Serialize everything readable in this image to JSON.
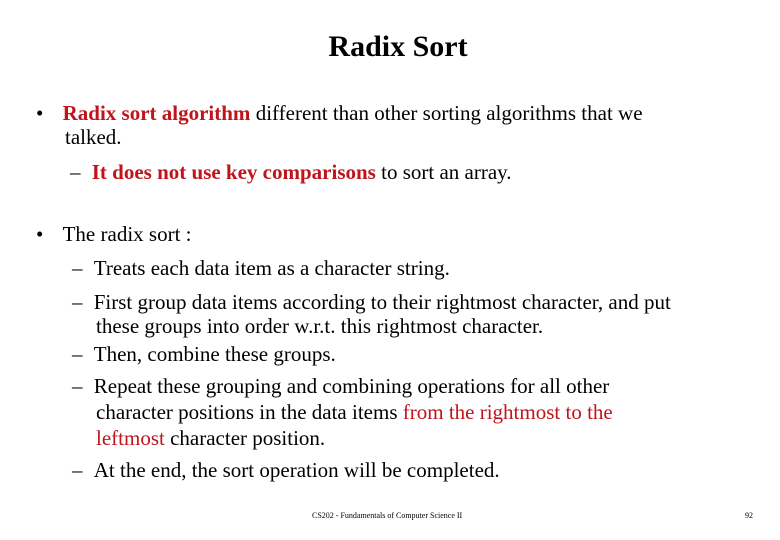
{
  "slide": {
    "title": "Radix Sort",
    "bullets": {
      "b1": {
        "marker": "•",
        "red_bold": "Radix sort algorithm",
        "rest": " different than other sorting algorithms that we",
        "cont": "talked.",
        "sub1": {
          "marker": "–",
          "red_bold": "It does not use key comparisons",
          "rest": " to sort an array."
        }
      },
      "b2": {
        "marker": "•",
        "text": "The radix sort :",
        "s1": "Treats each data item as a character string.",
        "s2a": "First group data items according to their rightmost character, and put",
        "s2b": "these groups into order w.r.t. this rightmost character.",
        "s3": "Then, combine these groups.",
        "s4a": "Repeat these grouping and combining operations for all other",
        "s4b_black": "character positions in the data items ",
        "s4b_red": "from the rightmost to the",
        "s4c_red": "leftmost",
        "s4c_black": " character position.",
        "s5": "At the end, the sort operation will be completed.",
        "dash": "–"
      }
    },
    "footer": {
      "course": "CS202 - Fundamentals of Computer Science II",
      "page": "92"
    },
    "colors": {
      "accent_red": "#c0141c"
    }
  }
}
